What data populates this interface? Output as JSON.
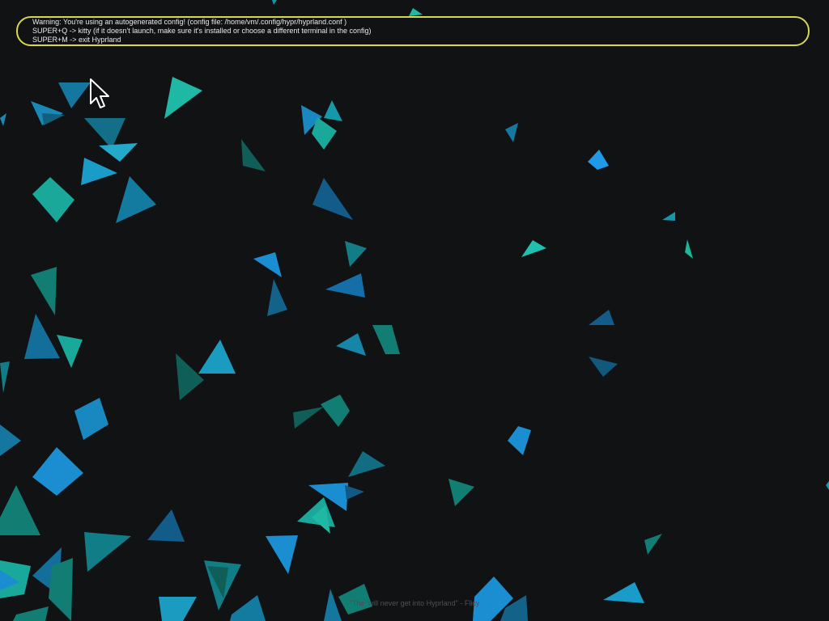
{
  "notification": {
    "lines": [
      "Warning: You're using an autogenerated config! (config file: /home/vm/.config/hypr/hyprland.conf )",
      "SUPER+Q -> kitty (if it doesn't launch, make sure it's installed or choose a different terminal in the config)",
      "SUPER+M -> exit Hyprland"
    ],
    "border_color": "#d6d84a"
  },
  "wallpaper": {
    "quote": "\"The 'will never get into Hyprland\" - Flicy"
  },
  "cursor": {
    "icon": "arrow-cursor-icon"
  },
  "colors": {
    "background": "#111214",
    "teal": "#1aa89a",
    "blue": "#1b82c4",
    "dark_teal": "#116a66"
  }
}
